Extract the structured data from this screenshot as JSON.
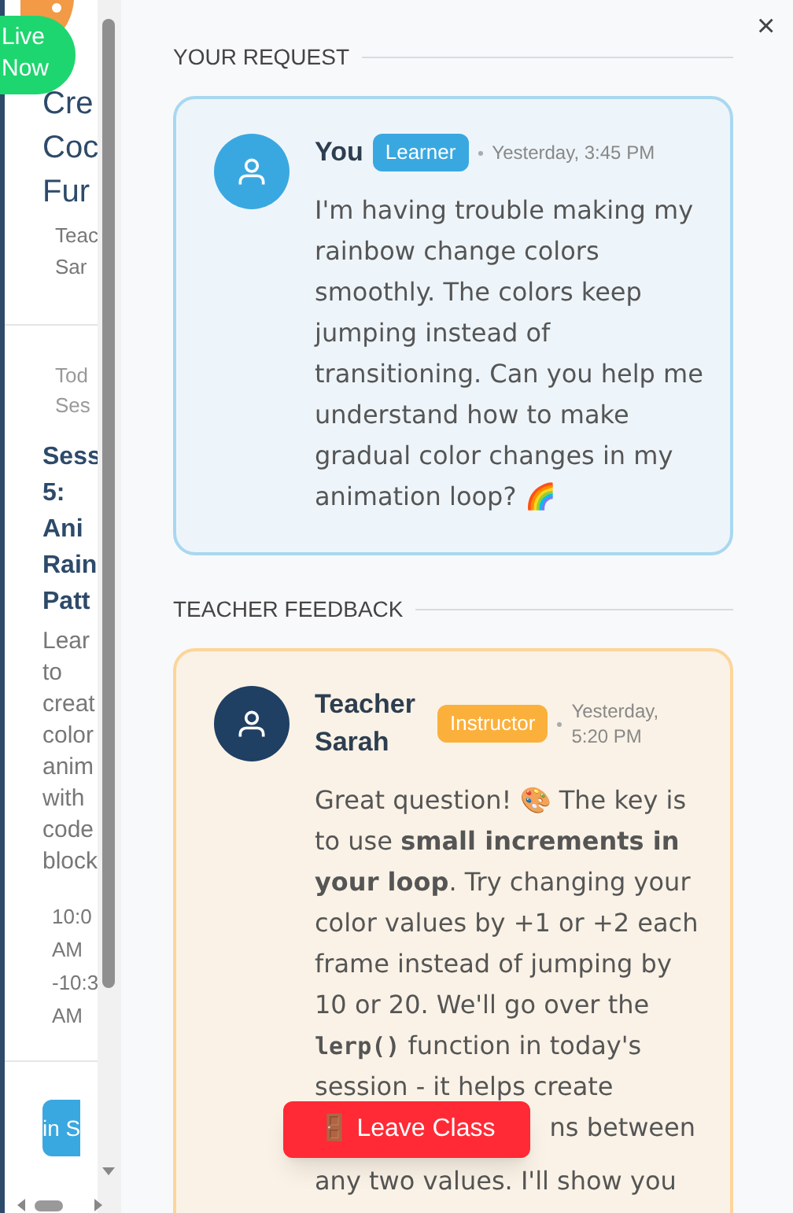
{
  "sidebar": {
    "live_badge": "Live\nNow",
    "course_title": "Cre\nCoc\nFur",
    "teacher": "Teac\nSar",
    "session_label": "Tod\nSes",
    "session_title": "Sess\n5:\nAni\nRain\nPatt",
    "session_description": "Lear\nto\ncreat\ncolor\nanim\nwith\ncode\nblock",
    "session_time": "10:0\nAM\n-10:3\nAM",
    "join_button": "in S"
  },
  "close_button": "×",
  "sections": [
    {
      "heading": "YOUR REQUEST",
      "message": {
        "kind": "learner",
        "author": "You",
        "role": "Learner",
        "time": "Yesterday, 3:45 PM",
        "text": [
          {
            "kind": "plain",
            "text": "I'm having trouble making my rainbow change colors smoothly. The colors keep jumping instead of transitioning. Can you help me understand how to make gradual color changes in my animation loop? 🌈"
          }
        ]
      }
    },
    {
      "heading": "TEACHER FEEDBACK",
      "message": {
        "kind": "instructor",
        "author": "Teacher Sarah",
        "role": "Instructor",
        "time": "Yesterday, 5:20 PM",
        "text": [
          {
            "kind": "plain",
            "text": "Great question! 🎨 The key is to use **small increments in your loop**. Try changing your color values by +1 or +2 each frame instead of jumping by 10 or 20. We'll go over the "
          },
          {
            "kind": "code",
            "text": "lerp()"
          },
          {
            "kind": "plain",
            "text": " function in today's session - it helps create"
          }
        ],
        "beside_button": "ns between",
        "after_button": "any two values. I'll show you"
      }
    }
  ],
  "leave_button": "🚪 Leave Class"
}
